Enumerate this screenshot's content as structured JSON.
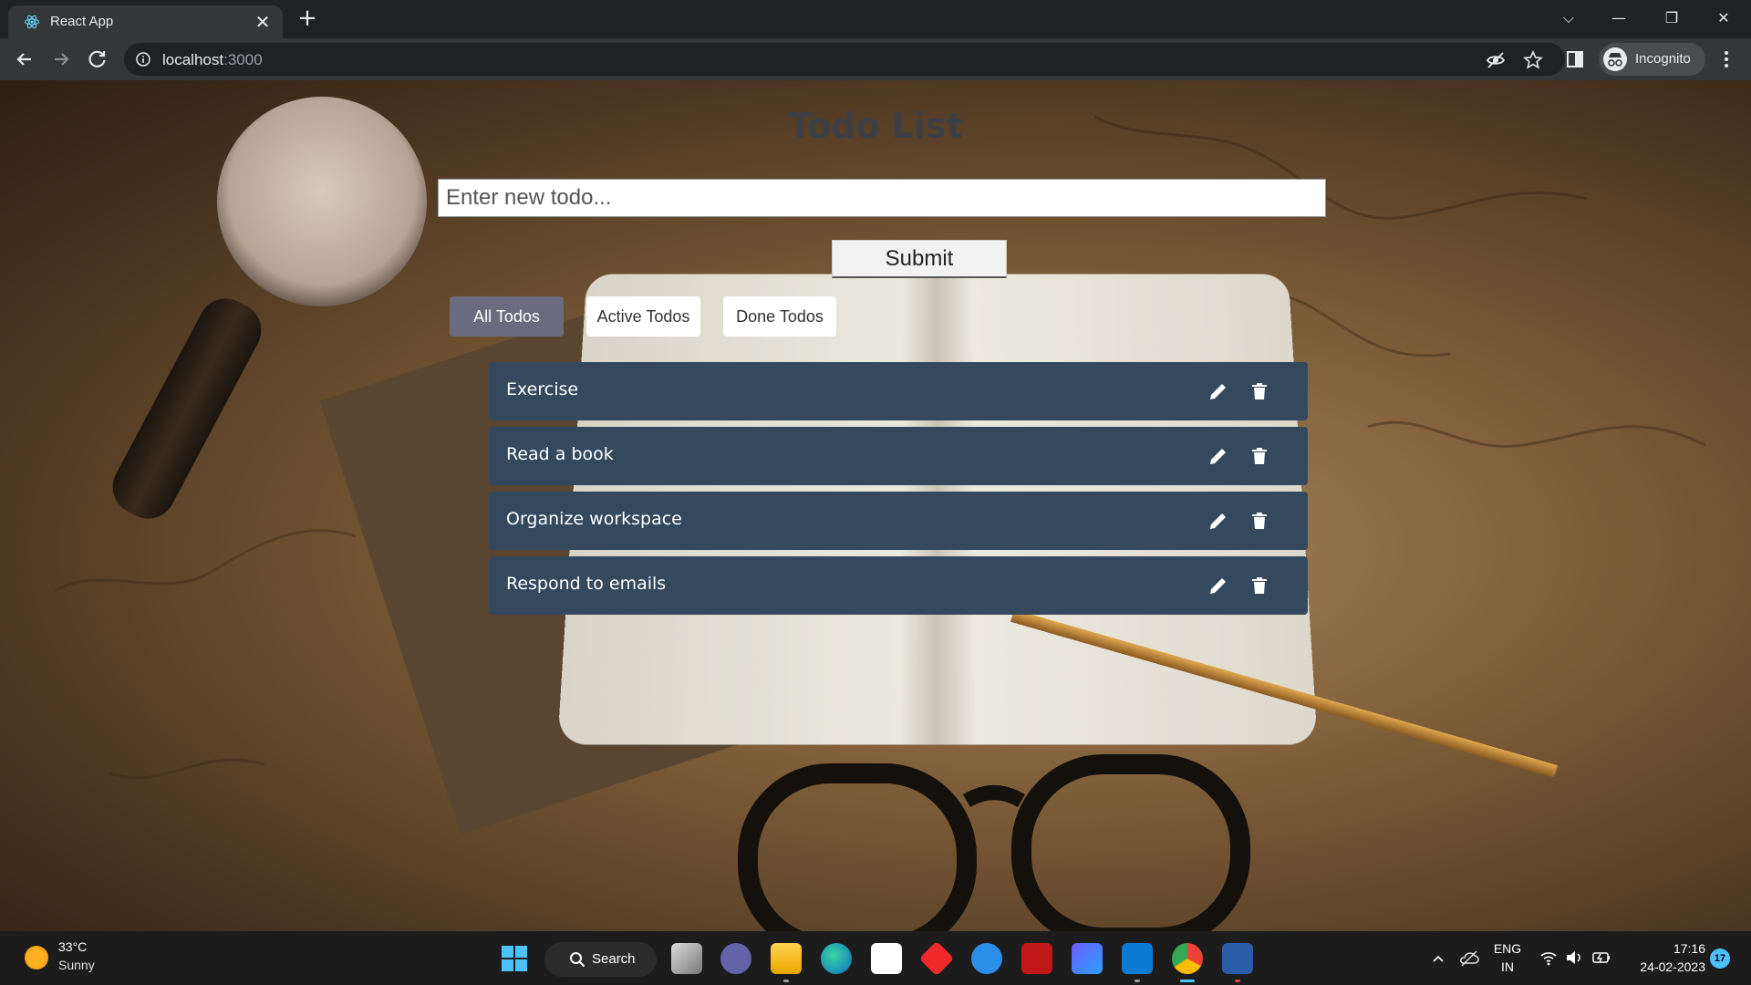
{
  "browser": {
    "tab_title": "React App",
    "url_host": "localhost",
    "url_port": ":3000",
    "profile_label": "Incognito"
  },
  "app": {
    "title": "Todo List",
    "input_placeholder": "Enter new todo...",
    "submit_label": "Submit",
    "filters": [
      {
        "label": "All Todos",
        "selected": true
      },
      {
        "label": "Active Todos",
        "selected": false
      },
      {
        "label": "Done Todos",
        "selected": false
      }
    ],
    "todos": [
      {
        "text": "Exercise"
      },
      {
        "text": "Read a book"
      },
      {
        "text": "Organize workspace"
      },
      {
        "text": "Respond to emails"
      }
    ],
    "colors": {
      "todo_bg": "#34495e",
      "filter_selected_bg": "#6b6b80"
    }
  },
  "taskbar": {
    "weather_temp": "33°C",
    "weather_desc": "Sunny",
    "search_label": "Search",
    "lang_top": "ENG",
    "lang_bottom": "IN",
    "time": "17:16",
    "date": "24-02-2023",
    "notification_count": "17"
  }
}
